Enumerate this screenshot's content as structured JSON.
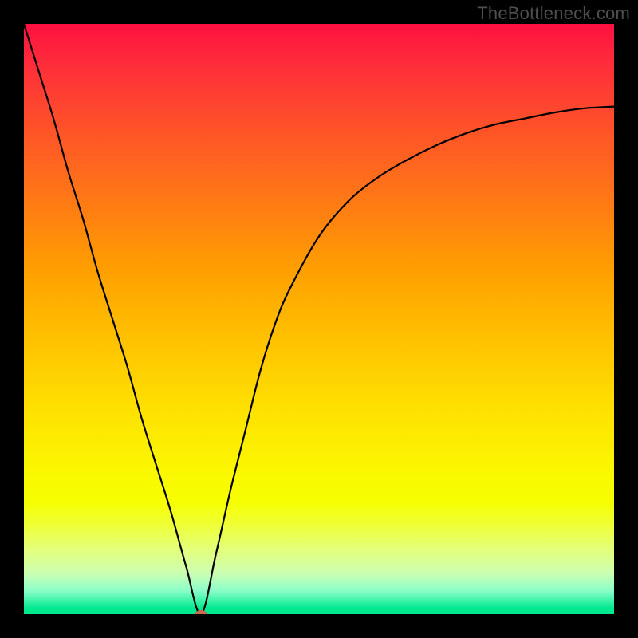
{
  "watermark": "TheBottleneck.com",
  "chart_data": {
    "type": "line",
    "title": "",
    "xlabel": "",
    "ylabel": "",
    "xlim": [
      0,
      100
    ],
    "ylim": [
      0,
      100
    ],
    "grid": false,
    "legend": false,
    "series": [
      {
        "name": "bottleneck-curve",
        "x": [
          0,
          2.5,
          5,
          7.5,
          10,
          12.5,
          15,
          17.5,
          20,
          22.5,
          25,
          27.5,
          30,
          32.5,
          35,
          37.5,
          40,
          42.5,
          45,
          50,
          55,
          60,
          65,
          70,
          75,
          80,
          85,
          90,
          95,
          100
        ],
        "values": [
          100,
          92,
          84,
          75,
          67,
          58,
          50,
          42,
          33,
          25,
          17,
          8,
          0,
          10,
          21,
          31,
          41,
          49,
          55,
          64,
          70,
          74,
          77,
          79.5,
          81.5,
          83,
          84,
          85,
          85.7,
          86
        ]
      }
    ],
    "marker": {
      "x": 30,
      "y": 0,
      "color": "#cc6a4e"
    },
    "gradient_stops": [
      {
        "pos": 0,
        "color": "#fd1040"
      },
      {
        "pos": 7,
        "color": "#fe2e3a"
      },
      {
        "pos": 18,
        "color": "#ff5328"
      },
      {
        "pos": 30,
        "color": "#ff7915"
      },
      {
        "pos": 42,
        "color": "#ffa000"
      },
      {
        "pos": 54,
        "color": "#ffc300"
      },
      {
        "pos": 65,
        "color": "#fee000"
      },
      {
        "pos": 75,
        "color": "#fbf600"
      },
      {
        "pos": 81,
        "color": "#f6ff00"
      },
      {
        "pos": 85,
        "color": "#efff39"
      },
      {
        "pos": 89,
        "color": "#e4ff7a"
      },
      {
        "pos": 93,
        "color": "#cdffb2"
      },
      {
        "pos": 96,
        "color": "#8cffc9"
      },
      {
        "pos": 99,
        "color": "#00e990"
      },
      {
        "pos": 100,
        "color": "#00e990"
      }
    ]
  }
}
